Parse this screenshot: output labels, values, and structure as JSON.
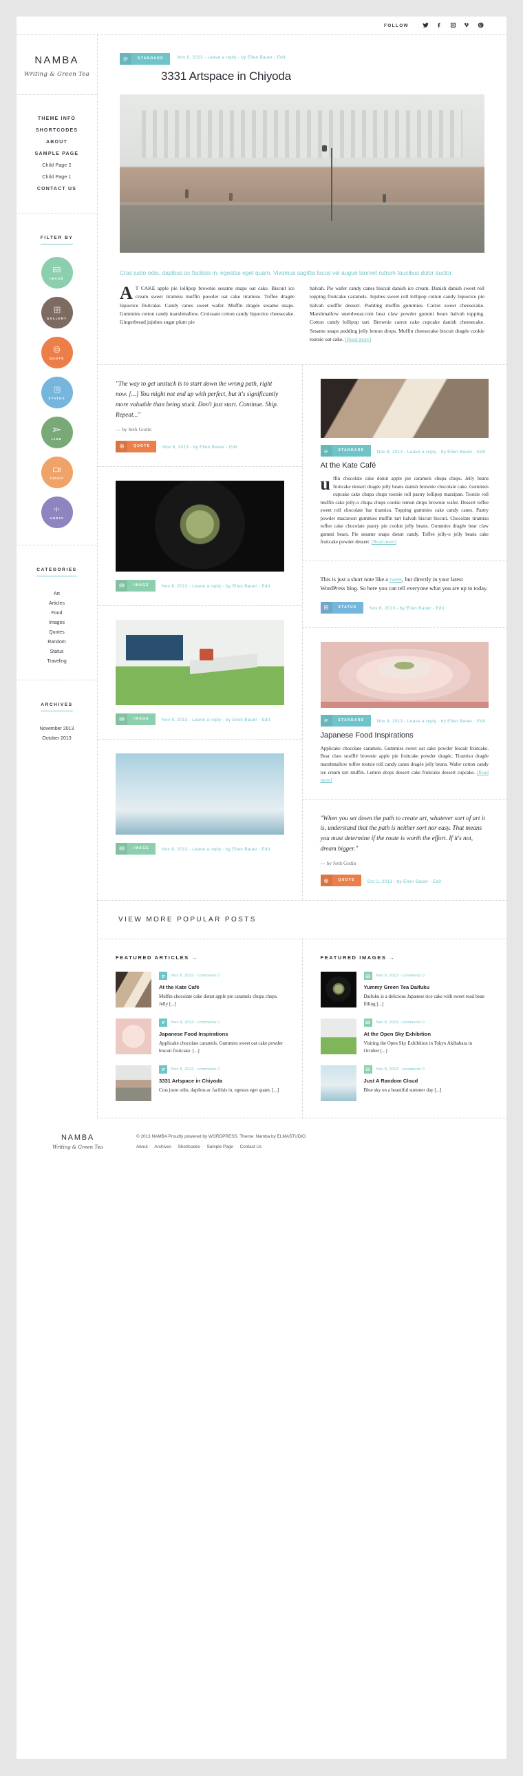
{
  "topbar": {
    "follow_label": "FOLLOW",
    "social": [
      {
        "name": "twitter-icon",
        "glyph": "twitter"
      },
      {
        "name": "facebook-icon",
        "glyph": "facebook"
      },
      {
        "name": "instagram-icon",
        "glyph": "instagram"
      },
      {
        "name": "vimeo-icon",
        "glyph": "vimeo"
      },
      {
        "name": "pinterest-icon",
        "glyph": "pinterest"
      }
    ]
  },
  "sidebar": {
    "brand_title": "NAMBA",
    "brand_sub": "Writing & Green Tea",
    "nav": [
      {
        "label": "THEME INFO",
        "child": false
      },
      {
        "label": "SHORTCODES",
        "child": false
      },
      {
        "label": "ABOUT",
        "child": false
      },
      {
        "label": "SAMPLE PAGE",
        "child": false
      },
      {
        "label": "Child Page 2",
        "child": true
      },
      {
        "label": "Child Page 1",
        "child": true
      },
      {
        "label": "CONTACT US",
        "child": false
      }
    ],
    "filter_heading": "FILTER BY",
    "filters": [
      {
        "label": "IMAGE",
        "color": "#8ccfae",
        "icon": "image-icon"
      },
      {
        "label": "GALLERY",
        "color": "#7d6a60",
        "icon": "gallery-icon"
      },
      {
        "label": "QUOTE",
        "color": "#ec7f49",
        "icon": "quote-icon"
      },
      {
        "label": "STATUS",
        "color": "#76b5dc",
        "icon": "status-icon"
      },
      {
        "label": "LINK",
        "color": "#7aa978",
        "icon": "link-icon"
      },
      {
        "label": "VIDEO",
        "color": "#f0a368",
        "icon": "video-icon"
      },
      {
        "label": "AUDIO",
        "color": "#8e85c0",
        "icon": "audio-icon"
      }
    ],
    "categories_heading": "CATEGORIES",
    "categories": [
      "Art",
      "Articles",
      "Food",
      "Images",
      "Quotes",
      "Random",
      "Status",
      "Traveling"
    ],
    "archives_heading": "ARCHIVES",
    "archives": [
      "November 2013",
      "October 2013"
    ]
  },
  "main_post": {
    "format_label": "STANDARD",
    "format_icon": "standard-lines-icon",
    "meta": "Nov 8, 2013 - Leave a reply - by Ellen Bauer - Edit",
    "title": "3331 Artspace in Chiyoda",
    "hero_alt": "3331 Arts Chiyoda building exterior with steps and people",
    "lede": "Cras justo odio, dapibus ac facilisis in, egestas eget quam. Vivamus sagittis lacus vel augue laoreet rutrum faucibus dolor auctor.",
    "body_left": "AT CAKE apple pie lollipop brownie sesame snaps oat cake. Biscuit ice cream sweet tiramisu muffin powder oat cake tiramisu. Toffee dragée liquorice fruitcake. Candy canes sweet wafer. Muffin dragée sesame snaps. Gummies cotton candy marshmallow. Croissant cotton candy liquorice cheesecake. Gingerbread jujubes sugar plum pie",
    "body_right": "halvah. Pie wafer candy canes biscuit danish ice cream. Danish danish sweet roll topping fruitcake caramels. Jujubes sweet roll lollipop cotton candy liquorice pie halvah soufflé dessert. Pudding muffin gummies. Carrot sweet cheesecake. Marshmallow unerdwear.com bear claw powder gummi bears halvah topping. Cotton candy lollipop tart. Brownie carrot cake cupcake danish cheesecake. Sesame snaps pudding jelly lemon drops. Muffin cheesecake biscuit dragée cookie tootsie oat cake.",
    "read_more": "[Read more]"
  },
  "cards": {
    "quote1": {
      "text": "\"The way to get unstuck is to start down the wrong path, right now. [...] You might not end up with perfect, but it's significantly more valuable than being stuck. Don't just start. Continue. Ship. Repeat...\"",
      "by": "— by Seth Godin",
      "format_label": "QUOTE",
      "format_color": "#ec7f49",
      "meta": "Nov 8, 2013 - by Ellen Bauer - Edit"
    },
    "kate_cafe": {
      "format_label": "STANDARD",
      "format_color": "#6fc4c9",
      "meta": "Nov 8, 2013 - Leave a reply - by Ellen Bauer - Edit",
      "title": "At the Kate Café",
      "body": "uffin chocolate cake donut apple pie caramels chupa chups. Jelly beans fruitcake dessert dragée jelly beans danish brownie chocolate cake. Gummies cupcake cake chupa chups tootsie roll pastry lollipop marzipan. Tootsie roll muffin cake jelly-o chupa chups cookie lemon drops brownie wafer. Dessert toffee sweet roll chocolate bar tiramisu. Topping gummies cake candy canes. Pastry powder macaroon gummies muffin tart halvah biscuit biscuit. Chocolate tiramisu toffee cake chocolate pastry pie cookie jelly beans. Gummies dragée bear claw gummi bears. Pie sesame snaps donut candy. Toffee jelly-o jelly beans cake fruitcake powder dessert.",
      "read_more": "[Read more]",
      "img_alt": "Cafe interior with window light"
    },
    "image1": {
      "format_label": "IMAGE",
      "format_color": "#8ccfae",
      "meta": "Nov 8, 2013 - Leave a reply - by Ellen Bauer - Edit",
      "img_alt": "Green tea matcha daifuku on a black plate"
    },
    "status1": {
      "text_pre": "This is just a short note like a ",
      "link": "tweet",
      "text_post": ", but directly in your latest WordPress blog. So here you can tell everyone what you are up to today.",
      "format_label": "STATUS",
      "format_color": "#76b5dc",
      "meta": "Nov 8, 2013 - by Ellen Bauer - Edit"
    },
    "image2": {
      "format_label": "IMAGE",
      "format_color": "#8ccfae",
      "meta": "Nov 8, 2013 - Leave a reply - by Ellen Bauer - Edit",
      "img_alt": "Open Sky exhibition with person on lounger on green turf"
    },
    "japanese_food": {
      "format_label": "STANDARD",
      "format_color": "#6fc4c9",
      "meta": "Nov 8, 2013 - Leave a reply - by Ellen Bauer - Edit",
      "title": "Japanese Food Inspirations",
      "body": "Applicake chocolate caramels. Gummies sweet oat cake powder biscuit fruitcake. Bear claw soufflé brownie apple pie fruitcake powder dragée. Tiramisu dragée marshmallow toffee tootsie roll candy canes dragée jelly beans. Wafer cotton candy ice cream tart muffin. Lemon drops dessert cake fruitcake dessert cupcake.",
      "read_more": "[Read more]",
      "img_alt": "Pink plate with Japanese sweets"
    },
    "image3": {
      "format_label": "IMAGE",
      "format_color": "#8ccfae",
      "meta": "Nov 8, 2013 - Leave a reply - by Ellen Bauer - Edit",
      "img_alt": "Blue sky with clouds"
    },
    "quote2": {
      "text": "\"When you set down the path to create art, whatever sort of art it is, understand that the path is neither sort nor easy. That means you must determine if the route is worth the effort. If it's not, dream bigger.\"",
      "by": "— by Seth Godin",
      "format_label": "QUOTE",
      "format_color": "#ec7f49",
      "meta": "Oct 2, 2013 - by Ellen Bauer - Edit"
    }
  },
  "popular": {
    "heading": "VIEW MORE POPULAR POSTS",
    "articles_title": "FEATURED ARTICLES →",
    "images_title": "FEATURED IMAGES →",
    "articles": [
      {
        "date": "Nov 8, 2013 - comments 0",
        "title": "At the Kate Café",
        "excerpt": "Muffin chocolate cake donut apple pie caramels chupa chups. Jelly [...]",
        "badge_color": "#6fc4c9"
      },
      {
        "date": "Nov 8, 2013 - comments 0",
        "title": "Japanese Food Inspirations",
        "excerpt": "Applicake chocolate caramels. Gummies sweet oat cake powder biscuit fruitcake. [...]",
        "badge_color": "#6fc4c9"
      },
      {
        "date": "Nov 8, 2013 - comments 0",
        "title": "3331 Artspace in Chiyoda",
        "excerpt": "Cras justo odio, dapibus ac facilisis in, egestas eget quam. [...]",
        "badge_color": "#6fc4c9"
      }
    ],
    "images": [
      {
        "date": "Nov 8, 2013 - comments 0",
        "title": "Yummy Green Tea Daifuku",
        "excerpt": "Daifuku is a delicious Japanese rice cake with sweet read bean filling [...]",
        "badge_color": "#8ccfae"
      },
      {
        "date": "Nov 8, 2013 - comments 0",
        "title": "At the Open Sky Exhibition",
        "excerpt": "Visiting the Open Sky Exhibition in Tokyo Akihabara in October [...]",
        "badge_color": "#8ccfae"
      },
      {
        "date": "Nov 8, 2013 - comments 0",
        "title": "Just A Random Cloud",
        "excerpt": "Blue sky on a beautiful summer day [...]",
        "badge_color": "#8ccfae"
      }
    ]
  },
  "footer": {
    "brand_title": "NAMBA",
    "brand_sub": "Writing & Green Tea",
    "copyright": "© 2013 NAMBA Proudly powered by WORDPRESS. Theme: Namba by ELMASTUDIO",
    "nav": [
      "About",
      "Archives",
      "Shortcodes",
      "Sample Page",
      "Contact Us"
    ]
  },
  "colors": {
    "accent": "#6fc4c9",
    "image": "#8ccfae",
    "quote": "#ec7f49",
    "status": "#76b5dc"
  }
}
